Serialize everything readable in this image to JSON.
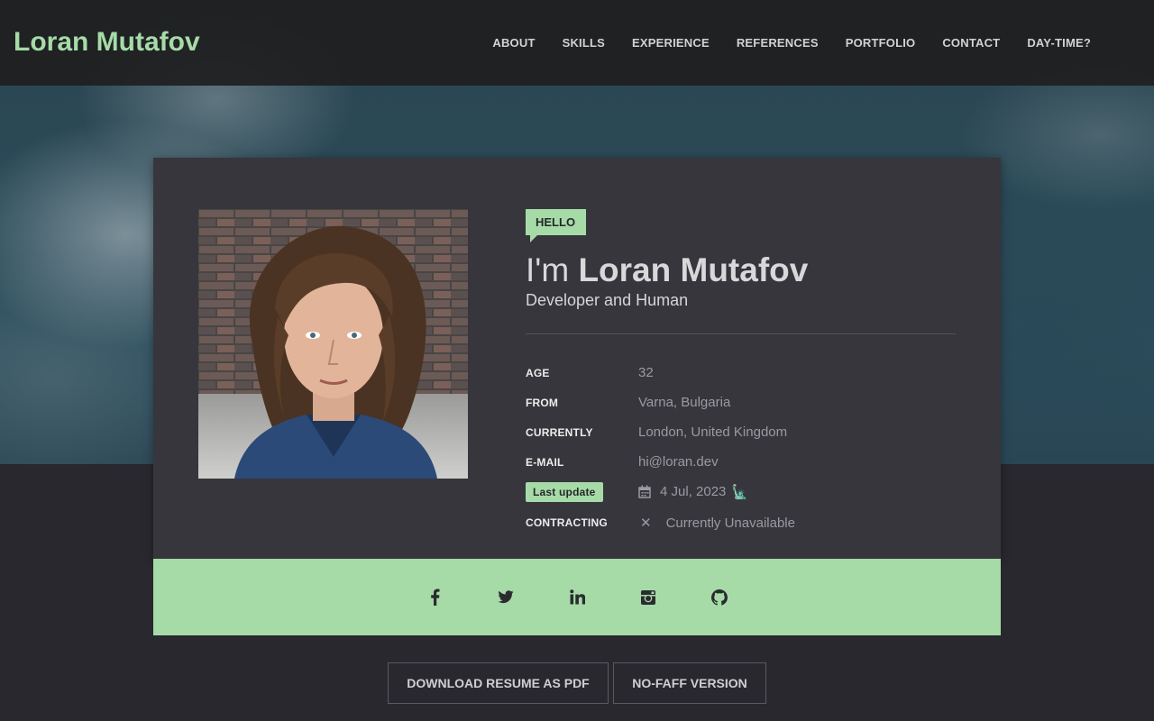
{
  "brand": "Loran Mutafov",
  "nav": [
    "ABOUT",
    "SKILLS",
    "EXPERIENCE",
    "REFERENCES",
    "PORTFOLIO",
    "CONTACT",
    "DAY-TIME?"
  ],
  "card": {
    "hello": "HELLO",
    "im": "I'm",
    "name": "Loran Mutafov",
    "subtitle": "Developer and Human",
    "rows": {
      "age": {
        "label": "AGE",
        "value": "32"
      },
      "from": {
        "label": "FROM",
        "value": "Varna, Bulgaria"
      },
      "currently": {
        "label": "CURRENTLY",
        "value": "London, United Kingdom"
      },
      "email": {
        "label": "E-MAIL",
        "value": "hi@loran.dev"
      },
      "last_update": {
        "label": "Last update",
        "value": "4 Jul, 2023",
        "emoji": "🗽"
      },
      "contracting": {
        "label": "CONTRACTING",
        "value": "Currently Unavailable"
      }
    }
  },
  "social": [
    "facebook-icon",
    "twitter-icon",
    "linkedin-icon",
    "instagram-icon",
    "github-icon"
  ],
  "buttons": {
    "pdf": "DOWNLOAD RESUME AS PDF",
    "nofaff": "NO-FAFF VERSION"
  },
  "colors": {
    "accent": "#a6dba8",
    "background": "#28282e",
    "card": "#36363c"
  }
}
